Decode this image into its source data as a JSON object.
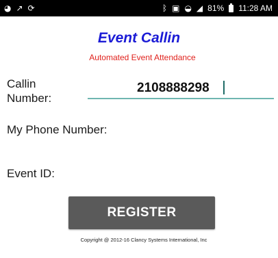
{
  "status_bar": {
    "left_icons": [
      "notification-icon",
      "missed-call-icon",
      "sync-icon"
    ],
    "right_icons": [
      "bluetooth-icon",
      "nfc-icon",
      "wifi-icon",
      "signal-icon",
      "battery-icon"
    ],
    "battery": "81%",
    "time": "11:28 AM"
  },
  "header": {
    "title": "Event Callin",
    "subtitle": "Automated Event Attendance",
    "title_color": "#1b1bd6",
    "subtitle_color": "#e0211c"
  },
  "form": {
    "callin_label": "Callin\nNumber:",
    "callin_value": "2108888298",
    "phone_label": "My Phone Number:",
    "event_label": "Event ID:",
    "accent_color": "#6fb6b0"
  },
  "actions": {
    "register_label": "REGISTER",
    "button_color": "#5a5a5a"
  },
  "footer": {
    "copyright": "Copyright @ 2012-16 Clancy Systems International, Inc"
  }
}
